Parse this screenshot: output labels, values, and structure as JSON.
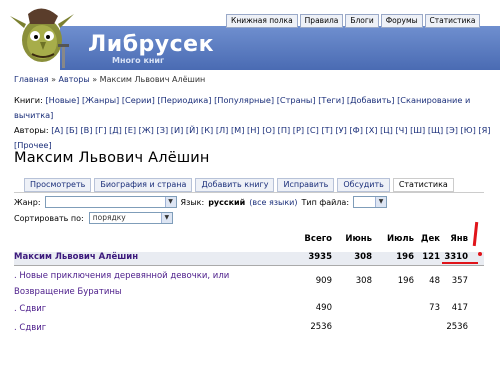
{
  "site": {
    "title": "Либрусек",
    "slogan": "Много книг"
  },
  "topnav": [
    "Книжная полка",
    "Правила",
    "Блоги",
    "Форумы",
    "Статистика"
  ],
  "breadcrumb": {
    "home": "Главная",
    "sep": " » ",
    "authors": "Авторы",
    "current": "Максим Львович Алёшин"
  },
  "nav": {
    "books_label": "Книги:",
    "books_links": [
      "[Новые]",
      "[Жанры]",
      "[Серии]",
      "[Периодика]",
      "[Популярные]",
      "[Страны]",
      "[Теги]",
      "[Добавить]",
      "[Сканирование и вычитка]"
    ],
    "authors_label": "Авторы:",
    "letters": [
      "[А]",
      "[Б]",
      "[В]",
      "[Г]",
      "[Д]",
      "[Е]",
      "[Ж]",
      "[З]",
      "[И]",
      "[Й]",
      "[К]",
      "[Л]",
      "[М]",
      "[Н]",
      "[О]",
      "[П]",
      "[Р]",
      "[С]",
      "[Т]",
      "[У]",
      "[Ф]",
      "[Х]",
      "[Ц]",
      "[Ч]",
      "[Ш]",
      "[Щ]",
      "[Э]",
      "[Ю]",
      "[Я]",
      "[Прочее]"
    ]
  },
  "author": {
    "name": "Максим Львович Алёшин"
  },
  "tabs": [
    "Просмотреть",
    "Биография и страна",
    "Добавить книгу",
    "Исправить",
    "Обсудить",
    "Статистика"
  ],
  "active_tab": "Статистика",
  "filters": {
    "genre_label": "Жанр:",
    "lang_label": "Язык:",
    "lang_value": "русский",
    "all_langs": "(все языки)",
    "filetype_label": "Тип файла:",
    "sort_label": "Сортировать по:",
    "sort_value": "порядку"
  },
  "stats": {
    "headers": [
      "Всего",
      "Июнь",
      "Июль",
      "Дек",
      "Янв"
    ],
    "author_row": {
      "name": "Максим Львович Алёшин",
      "values": [
        "3935",
        "308",
        "196",
        "121",
        "3310"
      ]
    },
    "books": [
      {
        "bullet": ".",
        "title": "Новые приключения деревянной девочки, или Возвращение Буратины",
        "values": [
          "909",
          "308",
          "196",
          "48",
          "357"
        ]
      },
      {
        "bullet": ".",
        "title": "Сдвиг",
        "values": [
          "490",
          "",
          "",
          "73",
          "417"
        ]
      },
      {
        "bullet": ".",
        "title": "Сдвиг",
        "values": [
          "2536",
          "",
          "",
          "",
          "2536"
        ]
      }
    ]
  },
  "colors": {
    "banner": "#5577bb",
    "link": "#1b2f7a",
    "book_link": "#4b1c8a",
    "annotation": "#e0141a"
  }
}
